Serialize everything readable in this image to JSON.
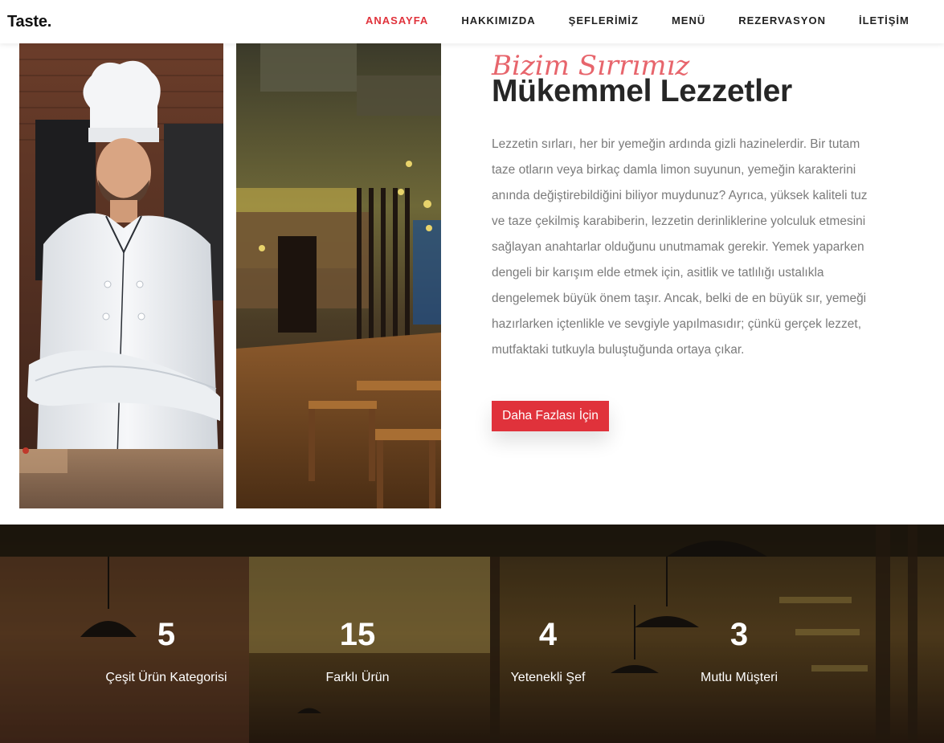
{
  "navbar": {
    "brand": "Taste.",
    "items": [
      {
        "label": "ANASAYFA",
        "active": true
      },
      {
        "label": "HAKKIMIZDA",
        "active": false
      },
      {
        "label": "ŞEFLERİMİZ",
        "active": false
      },
      {
        "label": "MENÜ",
        "active": false
      },
      {
        "label": "REZERVASYON",
        "active": false
      },
      {
        "label": "İLETİŞİM",
        "active": false
      }
    ]
  },
  "about": {
    "script_title": "Bizim Sırrımız",
    "title": "Mükemmel Lezzetler",
    "paragraph": "Lezzetin sırları, her bir yemeğin ardında gizli hazinelerdir. Bir tutam taze otların veya birkaç damla limon suyunun, yemeğin karakterini anında değiştirebildiğini biliyor muydunuz? Ayrıca, yüksek kaliteli tuz ve taze çekilmiş karabiberin, lezzetin derinliklerine yolculuk etmesini sağlayan anahtarlar olduğunu unutmamak gerekir. Yemek yaparken dengeli bir karışım elde etmek için, asitlik ve tatlılığı ustalıkla dengelemek büyük önem taşır. Ancak, belki de en büyük sır, yemeği hazırlarken içtenlikle ve sevgiyle yapılmasıdır; çünkü gerçek lezzet, mutfaktaki tutkuyla buluştuğunda ortaya çıkar.",
    "button_label": "Daha Fazlası İçin"
  },
  "stats": [
    {
      "number": "5",
      "label": "Çeşit Ürün Kategorisi"
    },
    {
      "number": "15",
      "label": "Farklı Ürün"
    },
    {
      "number": "4",
      "label": "Yetenekli Şef"
    },
    {
      "number": "3",
      "label": "Mutlu Müşteri"
    }
  ],
  "colors": {
    "accent": "#e0323b",
    "heading": "#262626",
    "body_text": "#7b7b7b"
  }
}
